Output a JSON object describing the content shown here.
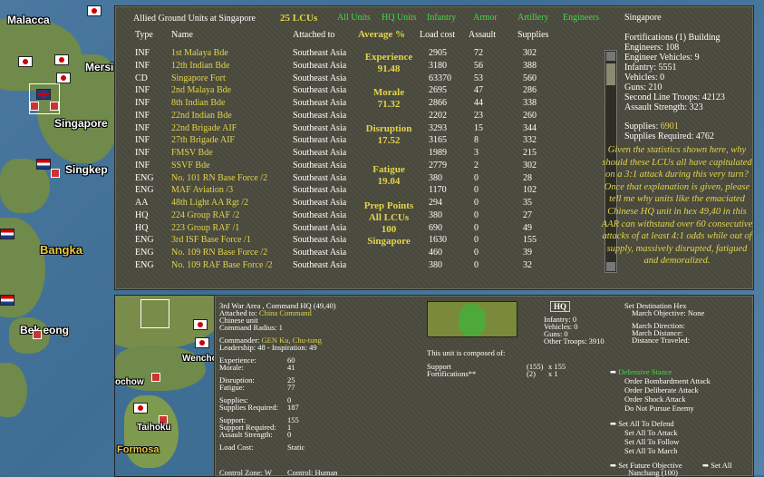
{
  "map": {
    "labels": [
      "Malacca",
      "Mersi",
      "Singapore",
      "Singkep",
      "Bangka",
      "Bek eong",
      "Wenchow",
      "ochow",
      "Taihoku",
      "Formosa"
    ]
  },
  "top": {
    "title": "Allied Ground Units at Singapore",
    "lcu_count": "25 LCUs",
    "filters": [
      "All Units",
      "HQ Units",
      "Infantry",
      "Armor",
      "Artillery",
      "Engineers"
    ],
    "location": "Singapore",
    "headers": {
      "type": "Type",
      "name": "Name",
      "attached": "Attached to",
      "average": "Average %",
      "load": "Load cost",
      "assault": "Assault",
      "supplies": "Supplies"
    },
    "rows": [
      {
        "type": "INF",
        "name": "1st Malaya Bde",
        "att": "Southeast Asia",
        "load": "2905",
        "as": "72",
        "sup": "302"
      },
      {
        "type": "INF",
        "name": "12th Indian Bde",
        "att": "Southeast Asia",
        "load": "3180",
        "as": "56",
        "sup": "388"
      },
      {
        "type": "CD",
        "name": "Singapore Fort",
        "att": "Southeast Asia",
        "load": "63370",
        "as": "53",
        "sup": "560"
      },
      {
        "type": "INF",
        "name": "2nd Malaya Bde",
        "att": "Southeast Asia",
        "load": "2695",
        "as": "47",
        "sup": "286"
      },
      {
        "type": "INF",
        "name": "8th Indian Bde",
        "att": "Southeast Asia",
        "load": "2866",
        "as": "44",
        "sup": "338"
      },
      {
        "type": "INF",
        "name": "22nd Indian Bde",
        "att": "Southeast Asia",
        "load": "2202",
        "as": "23",
        "sup": "260"
      },
      {
        "type": "INF",
        "name": "22nd Brigade AIF",
        "att": "Southeast Asia",
        "load": "3293",
        "as": "15",
        "sup": "344"
      },
      {
        "type": "INF",
        "name": "27th Brigade AIF",
        "att": "Southeast Asia",
        "load": "3165",
        "as": "8",
        "sup": "332"
      },
      {
        "type": "INF",
        "name": "FMSV Bde",
        "att": "Southeast Asia",
        "load": "1989",
        "as": "3",
        "sup": "215"
      },
      {
        "type": "INF",
        "name": "SSVF Bde",
        "att": "Southeast Asia",
        "load": "2779",
        "as": "2",
        "sup": "302"
      },
      {
        "type": "ENG",
        "name": "No. 101 RN Base Force /2",
        "att": "Southeast Asia",
        "load": "380",
        "as": "0",
        "sup": "28"
      },
      {
        "type": "ENG",
        "name": "MAF Aviation /3",
        "att": "Southeast Asia",
        "load": "1170",
        "as": "0",
        "sup": "102"
      },
      {
        "type": "AA",
        "name": "48th Light AA Rgt /2",
        "att": "Southeast Asia",
        "load": "294",
        "as": "0",
        "sup": "35"
      },
      {
        "type": "HQ",
        "name": "224 Group RAF /2",
        "att": "Southeast Asia",
        "load": "380",
        "as": "0",
        "sup": "27"
      },
      {
        "type": "HQ",
        "name": "223 Group RAF /1",
        "att": "Southeast Asia",
        "load": "690",
        "as": "0",
        "sup": "49"
      },
      {
        "type": "ENG",
        "name": "3rd ISF Base Force /1",
        "att": "Southeast Asia",
        "load": "1630",
        "as": "0",
        "sup": "155"
      },
      {
        "type": "ENG",
        "name": "No. 109 RN Base Force /2",
        "att": "Southeast Asia",
        "load": "460",
        "as": "0",
        "sup": "39"
      },
      {
        "type": "ENG",
        "name": "No. 109 RAF Base Force /2",
        "att": "Southeast Asia",
        "load": "380",
        "as": "0",
        "sup": "32"
      }
    ],
    "averages": [
      {
        "label": "Experience",
        "value": "91.48"
      },
      {
        "label": "Morale",
        "value": "71.32"
      },
      {
        "label": "Disruption",
        "value": "17.52"
      },
      {
        "label": "Fatigue",
        "value": "19.04"
      }
    ],
    "prep": {
      "line1": "Prep Points",
      "line2": "All LCUs",
      "line3": "100",
      "line4": "Singapore"
    },
    "stats": [
      "Fortifications (1) Building",
      "Engineers: 108",
      "Engineer Vehicles: 9",
      "Infantry: 5551",
      "Vehicles: 0",
      "Guns: 210",
      "Second Line Troops: 42123",
      "Assault Strength: 323"
    ],
    "supplies_label": "Supplies:",
    "supplies_value": "6901",
    "supplies_required": "Supplies Required: 4762",
    "annotation": "Given the statistics shown here, why should these LCUs all have capitulated on a 3:1 attack during this very turn? Once that explanation is given, please tell me why units like the emaciated Chinese HQ unit in hex 49,40 in this AAR can withstand over 60 consecutive attacks of at least 4:1 odds while out of supply, massively disrupted, fatigued and demoralized."
  },
  "bottom": {
    "unit_name": "3rd War Area , Command HQ (49,40)",
    "attached_label": "Attached to:",
    "attached_value": "China Command",
    "nation": "Chinese unit",
    "radius": "Command Radius: 1",
    "commander_label": "Commander:",
    "commander_value": "GEN Ku, Chu-tung",
    "leadership": "Leadership: 48 - Inspiration: 49",
    "experience_label": "Experience:",
    "experience_value": "60",
    "morale_label": "Morale:",
    "morale_value": "41",
    "disruption_label": "Disruption:",
    "disruption_value": "25",
    "fatigue_label": "Fatigue:",
    "fatigue_value": "77",
    "supplies_label": "Supplies:",
    "supplies_value": "0",
    "supreq_label": "Supplies Required:",
    "supreq_value": "187",
    "support_label": "Support:",
    "support_value": "155",
    "supportreq_label": "Support Required:",
    "supportreq_value": "1",
    "assault_label": "Assault Strength:",
    "assault_value": "0",
    "loadcost_label": "Load Cost:",
    "loadcost_value": "Static",
    "control_zone": "Control Zone: W",
    "control": "Control: Human",
    "badge": "HQ",
    "troops": [
      "Infantry: 0",
      "Vehicles: 0",
      "Guns: 0",
      "Other Troops: 3910"
    ],
    "composed": "This unit is composed of:",
    "comp_rows": [
      {
        "name": "Support",
        "count": "(155)",
        "x": "x 155"
      },
      {
        "name": "Fortifications**",
        "count": "(2)",
        "x": "x 1"
      }
    ],
    "destination": [
      "Set Destination Hex",
      "March Objective: None",
      "March Direction:",
      "March Distance:",
      "Distance Traveled:"
    ],
    "defensive": "Defensive Stance",
    "orders": [
      "Order Bombardment Attack",
      "Order Deliberate Attack",
      "Order Shock Attack",
      "Do Not Pursue Enemy"
    ],
    "set_all": [
      "Set All To Defend",
      "Set All To Attack",
      "Set All To Follow",
      "Set All To March"
    ],
    "future": "Set Future Objective",
    "future_value": "Nanchang (100)",
    "set_all_btn": "Set All"
  }
}
